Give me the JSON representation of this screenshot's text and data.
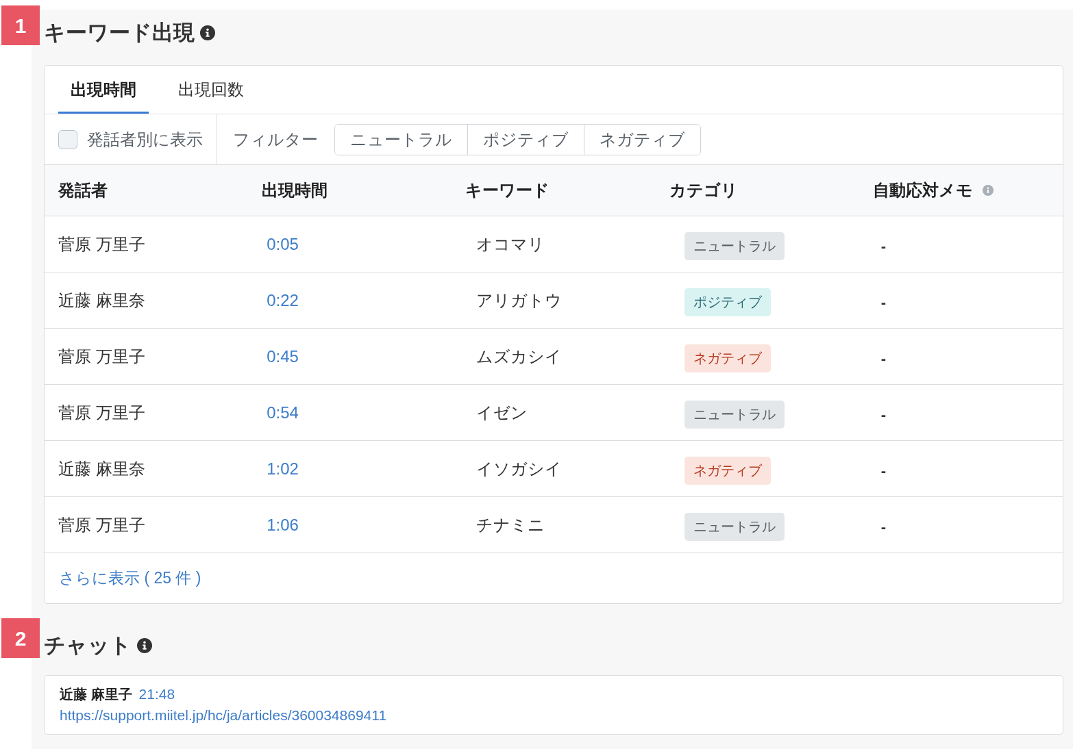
{
  "keyword_section": {
    "number": "1",
    "title": "キーワード出現",
    "tabs": [
      {
        "label": "出現時間",
        "selected": true
      },
      {
        "label": "出現回数",
        "selected": false
      }
    ],
    "speaker_toggle": {
      "label": "発話者別に表示",
      "checked": false
    },
    "filter": {
      "label": "フィルター",
      "options": [
        {
          "label": "ニュートラル",
          "selected": false
        },
        {
          "label": "ポジティブ",
          "selected": false
        },
        {
          "label": "ネガティブ",
          "selected": false
        }
      ]
    },
    "table": {
      "columns": [
        {
          "label": "発話者",
          "info": false
        },
        {
          "label": "出現時間",
          "info": false
        },
        {
          "label": "キーワード",
          "info": false
        },
        {
          "label": "カテゴリ",
          "info": false
        },
        {
          "label": "自動応対メモ",
          "info": true
        }
      ],
      "rows": [
        {
          "speaker": "菅原 万里子",
          "time": "0:05",
          "keyword": "オコマリ",
          "category": {
            "label": "ニュートラル",
            "kind": "neutral"
          },
          "memo": "-"
        },
        {
          "speaker": "近藤 麻里奈",
          "time": "0:22",
          "keyword": "アリガトウ",
          "category": {
            "label": "ポジティブ",
            "kind": "positive"
          },
          "memo": "-"
        },
        {
          "speaker": "菅原 万里子",
          "time": "0:45",
          "keyword": "ムズカシイ",
          "category": {
            "label": "ネガティブ",
            "kind": "negative"
          },
          "memo": "-"
        },
        {
          "speaker": "菅原 万里子",
          "time": "0:54",
          "keyword": "イゼン",
          "category": {
            "label": "ニュートラル",
            "kind": "neutral"
          },
          "memo": "-"
        },
        {
          "speaker": "近藤 麻里奈",
          "time": "1:02",
          "keyword": "イソガシイ",
          "category": {
            "label": "ネガティブ",
            "kind": "negative"
          },
          "memo": "-"
        },
        {
          "speaker": "菅原 万里子",
          "time": "1:06",
          "keyword": "チナミニ",
          "category": {
            "label": "ニュートラル",
            "kind": "neutral"
          },
          "memo": "-"
        }
      ]
    },
    "show_more": "さらに表示 ( 25 件 )"
  },
  "chat_section": {
    "number": "2",
    "title": "チャット",
    "messages": [
      {
        "sender": "近藤 麻里子",
        "time": "21:48",
        "text": "https://support.miitel.jp/hc/ja/articles/360034869411"
      }
    ]
  }
}
